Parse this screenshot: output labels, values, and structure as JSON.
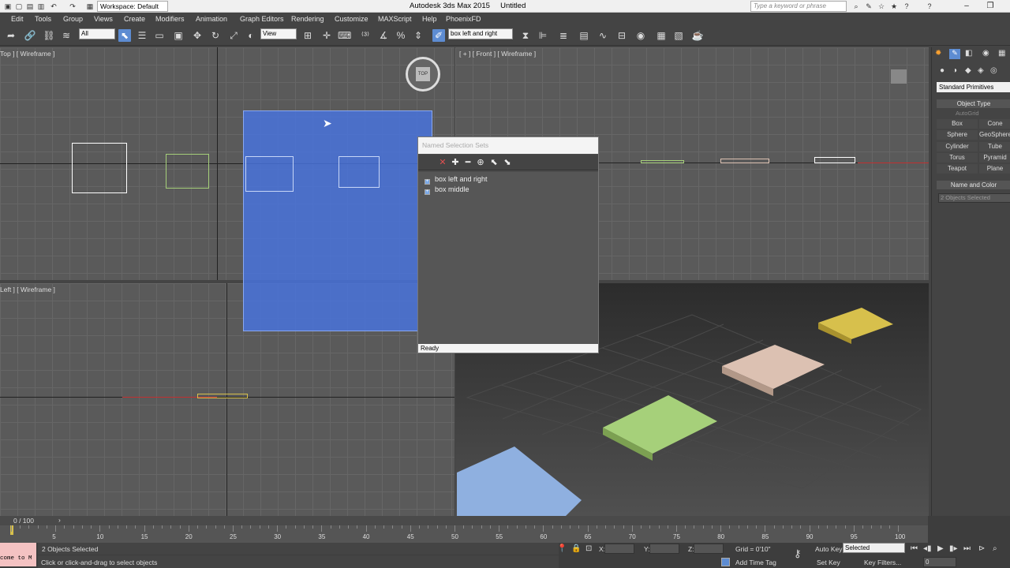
{
  "window": {
    "app_title": "Autodesk 3ds Max 2015",
    "doc_title": "Untitled",
    "workspace": "Workspace: Default",
    "search_placeholder": "Type a keyword or phrase"
  },
  "menu": [
    "Edit",
    "Tools",
    "Group",
    "Views",
    "Create",
    "Modifiers",
    "Animation",
    "Graph Editors",
    "Rendering",
    "Customize",
    "MAXScript",
    "Help",
    "PhoenixFD"
  ],
  "toolbar": {
    "filter": "All",
    "ref_coord": "View",
    "selection_set": "box left and right"
  },
  "viewports": {
    "top_label": "Top ] [ Wireframe ]",
    "front_label": "[ + ] [ Front ] [ Wireframe ]",
    "left_label": "Left ] [ Wireframe ]",
    "viewcube_top": "TOP"
  },
  "named_selection_sets": {
    "title": "Named Selection Sets",
    "items": [
      "box left and right",
      "box middle"
    ],
    "status": "Ready"
  },
  "command_panel": {
    "category": "Standard Primitives",
    "object_type_header": "Object Type",
    "autogrid": "AutoGrid",
    "buttons": [
      "Box",
      "Cone",
      "Sphere",
      "GeoSphere",
      "Cylinder",
      "Tube",
      "Torus",
      "Pyramid",
      "Teapot",
      "Plane"
    ],
    "name_color_header": "Name and Color",
    "name_field": "2 Objects Selected"
  },
  "timeline": {
    "frame_range": "0 / 100",
    "ticks": [
      "5",
      "10",
      "15",
      "20",
      "25",
      "30",
      "35",
      "40",
      "45",
      "50",
      "55",
      "60",
      "65",
      "70",
      "75",
      "80",
      "85",
      "90",
      "95",
      "100"
    ]
  },
  "status": {
    "selection_info": "2 Objects Selected",
    "prompt": "Click or click-and-drag to select objects",
    "maxscript_text": "come to M",
    "x_label": "X:",
    "y_label": "Y:",
    "z_label": "Z:",
    "grid": "Grid = 0'10\"",
    "add_time_tag": "Add Time Tag",
    "auto_key": "Auto Key",
    "set_key": "Set Key",
    "selected": "Selected",
    "key_filters": "Key Filters...",
    "frame": "0"
  },
  "colors": {
    "selection_rect": "#4874e0",
    "box_green": "#a6d07a",
    "box_pink": "#dcc1b2",
    "box_yellow": "#d7c04c",
    "box_blue": "#8fb0e0"
  }
}
